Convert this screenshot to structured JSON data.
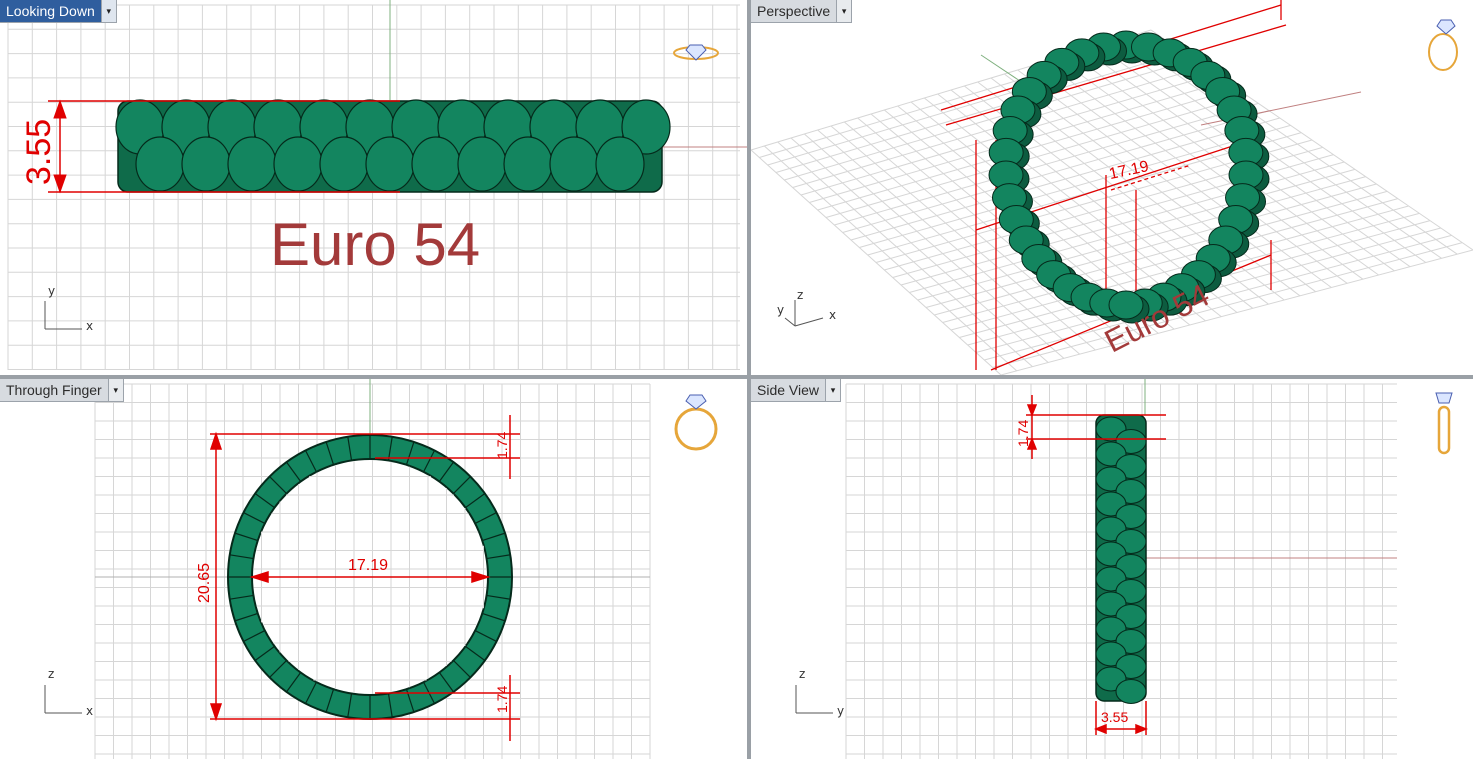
{
  "viewports": [
    {
      "key": "top",
      "title": "Looking Down",
      "active": true
    },
    {
      "key": "persp",
      "title": "Perspective",
      "active": false
    },
    {
      "key": "front",
      "title": "Through Finger",
      "active": false
    },
    {
      "key": "right",
      "title": "Side View",
      "active": false
    }
  ],
  "dropdown_glyph": "▾",
  "colors": {
    "gem": "#13855f",
    "gem_edge": "#052a1b",
    "dimension": "#e00000",
    "grid": "#d6d6d6",
    "label_text": "#a33a3a"
  },
  "top": {
    "band_width": "3.55",
    "size_label": "Euro 54",
    "axis_x": "x",
    "axis_y": "y"
  },
  "persp": {
    "inner_diameter": "17.19",
    "size_label": "Euro 54",
    "axis_x": "x",
    "axis_y": "y",
    "axis_z": "z"
  },
  "front": {
    "outer_diameter": "20.65",
    "inner_diameter": "17.19",
    "thickness_top": "1.74",
    "thickness_bottom": "1.74",
    "axis_x": "x",
    "axis_z": "z"
  },
  "right": {
    "thickness": "1.74",
    "band_width": "3.55",
    "axis_y": "y",
    "axis_z": "z"
  },
  "widgets": {
    "top": "ring-view-widget-icon",
    "persp": "ring-view-widget-icon",
    "front": "ring-view-widget-icon",
    "right": "ring-view-widget-icon"
  }
}
